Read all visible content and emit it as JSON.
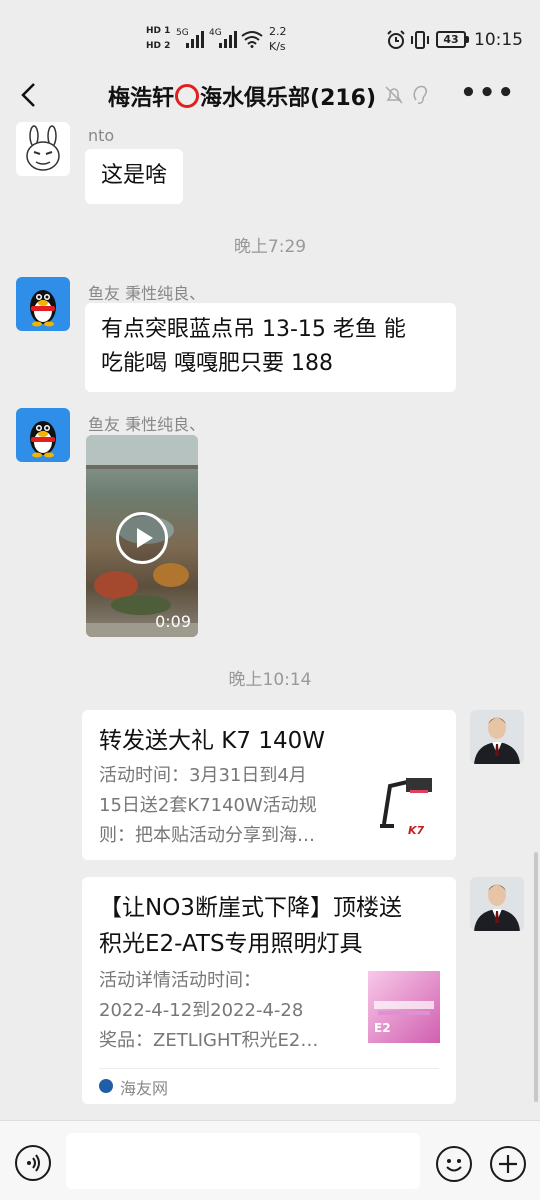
{
  "status_bar": {
    "hd1": "HD 1",
    "hd2": "HD 2",
    "net1": "5G",
    "net2": "4G",
    "speed": "2.2",
    "speed_unit": "K/s",
    "battery": "43",
    "time": "10:15"
  },
  "header": {
    "title_name": "梅浩轩",
    "title_rest": "海水俱乐部(216)"
  },
  "messages": [
    {
      "sender": "nto",
      "text": "这是啥"
    },
    {
      "time": "晚上7:29"
    },
    {
      "sender": "鱼友 秉性纯良、",
      "text_line1": "有点突眼蓝点吊 13-15 老鱼 能",
      "text_line2": "吃能喝 嘎嘎肥只要 188"
    },
    {
      "sender": "鱼友 秉性纯良、",
      "video_duration": "0:09"
    },
    {
      "time": "晚上10:14"
    },
    {
      "card_title": "转发送大礼 K7 140W",
      "card_desc": [
        "活动时间：3月31日到4月",
        "15日送2套K7140W活动规",
        "则：把本贴活动分享到海…"
      ],
      "thumb_text": "K7"
    },
    {
      "card_title": [
        "【让NO3断崖式下降】顶楼送",
        "积光E2-ATS专用照明灯具"
      ],
      "card_desc": [
        "活动详情活动时间：",
        "2022-4-12到2022-4-28",
        "奖品：ZETLIGHT积光E2…"
      ],
      "thumb_text": "E2",
      "source": "海友网"
    }
  ],
  "colors": {
    "background": "#ededed",
    "bubble": "#ffffff",
    "secondary_text": "#888888",
    "title_ring": "#e02020"
  }
}
